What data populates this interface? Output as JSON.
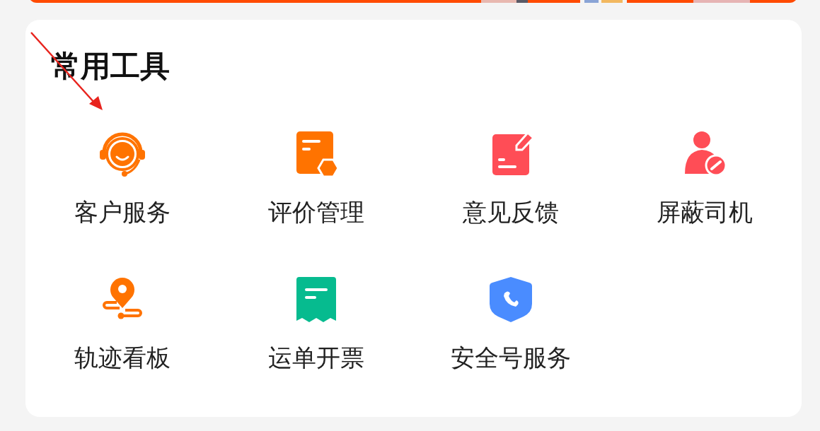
{
  "section": {
    "title": "常用工具"
  },
  "tools": [
    {
      "label": "客户服务",
      "kind": "headset"
    },
    {
      "label": "评价管理",
      "kind": "review"
    },
    {
      "label": "意见反馈",
      "kind": "feedback"
    },
    {
      "label": "屏蔽司机",
      "kind": "block"
    },
    {
      "label": "轨迹看板",
      "kind": "track"
    },
    {
      "label": "运单开票",
      "kind": "invoice"
    },
    {
      "label": "安全号服务",
      "kind": "secure"
    }
  ]
}
